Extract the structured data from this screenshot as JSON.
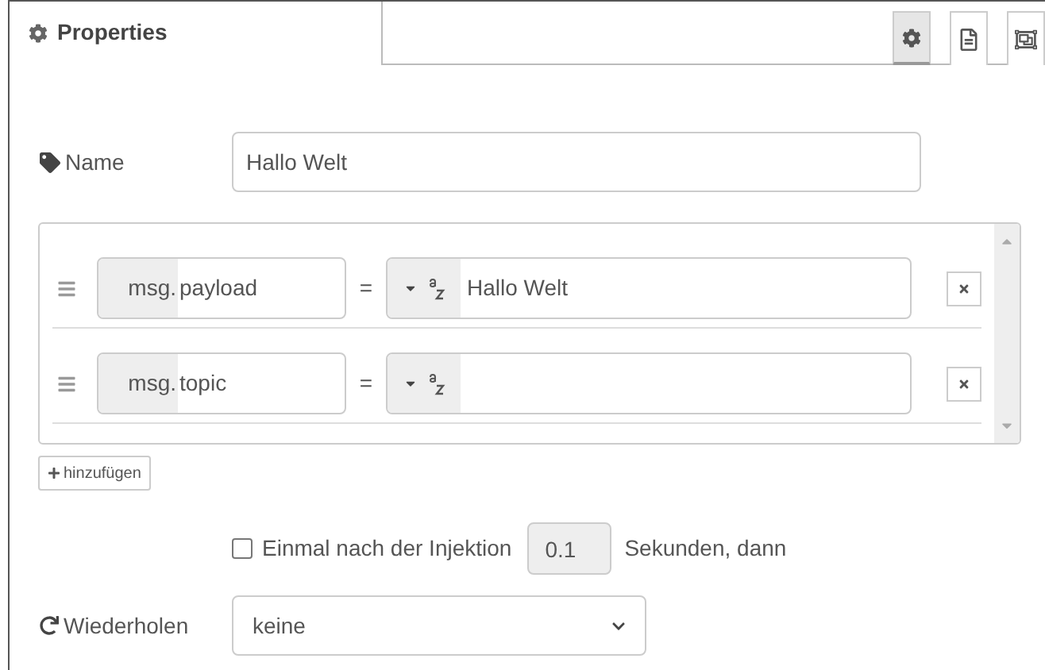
{
  "header": {
    "title": "Properties"
  },
  "tabs": [
    {
      "kind": "settings",
      "selected": true
    },
    {
      "kind": "description",
      "selected": false
    },
    {
      "kind": "appearance",
      "selected": false
    }
  ],
  "name": {
    "label": "Name",
    "value": "Hallo Welt"
  },
  "properties": [
    {
      "prefix": "msg.",
      "property": "payload",
      "operator": "=",
      "value": "Hallo Welt"
    },
    {
      "prefix": "msg.",
      "property": "topic",
      "operator": "="
    }
  ],
  "add_button": "hinzufügen",
  "once": {
    "checked": false,
    "label": "Einmal nach der Injektion",
    "delay": "0.1",
    "suffix": "Sekunden, dann"
  },
  "repeat": {
    "label": "Wiederholen",
    "value": "keine"
  }
}
